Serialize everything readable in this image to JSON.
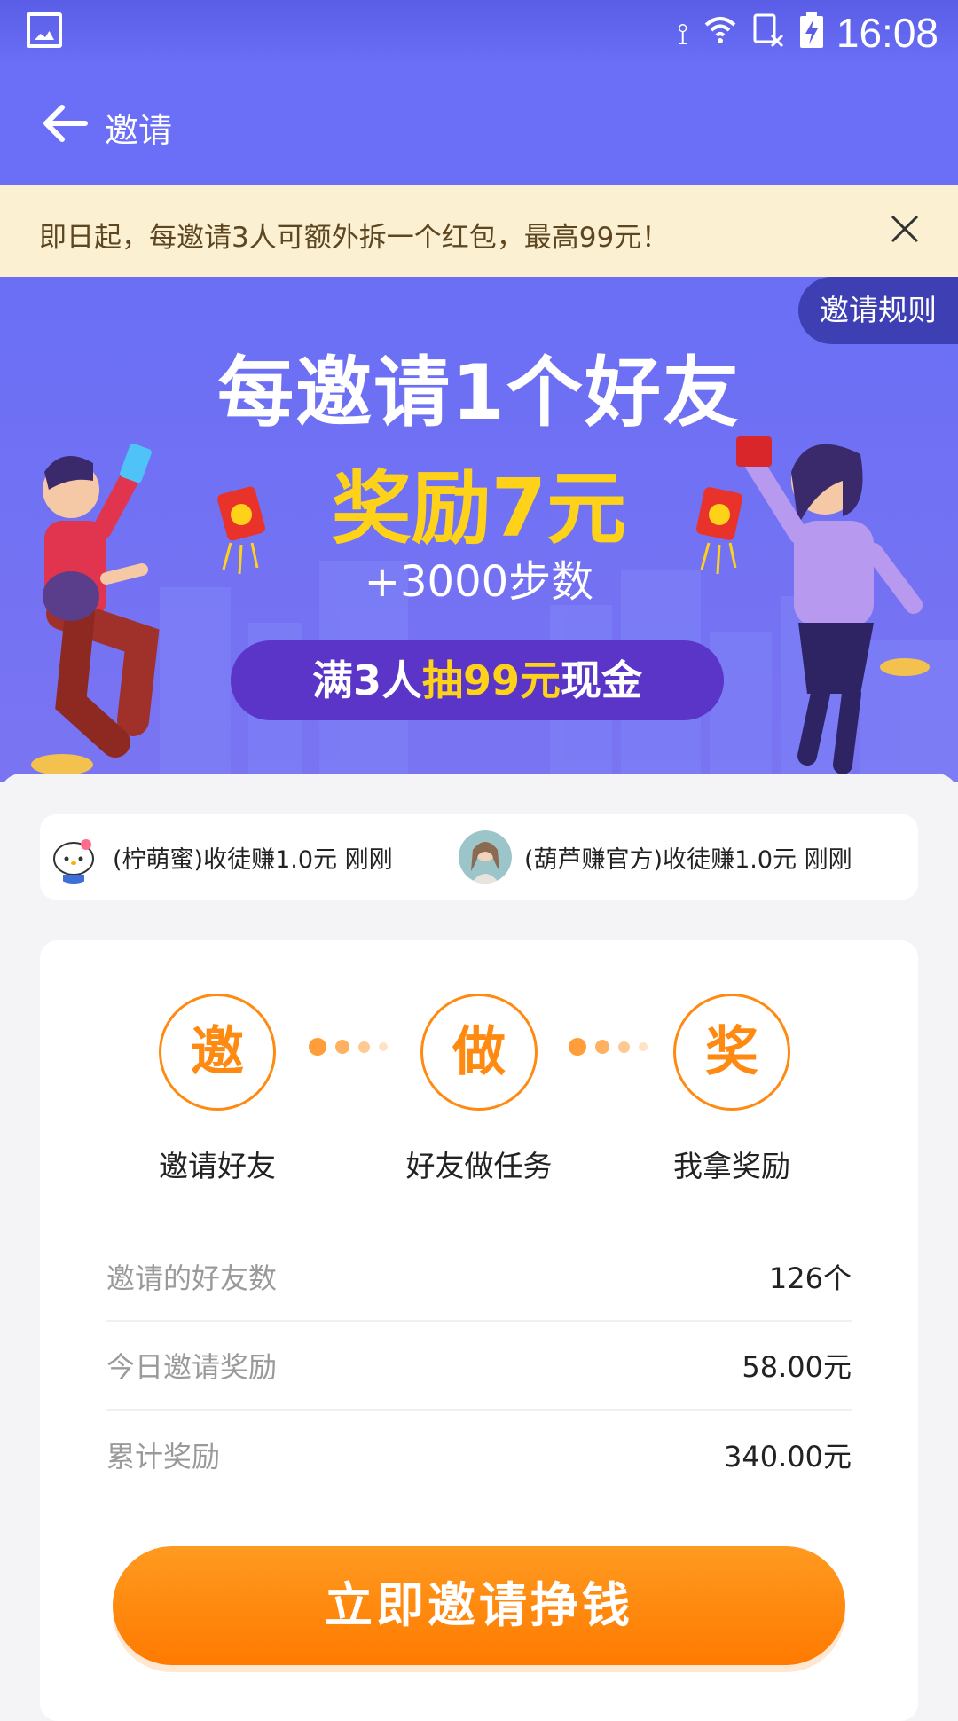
{
  "status_bar": {
    "time": "16:08",
    "icons": [
      "image-icon",
      "vibrate-mute-icon",
      "wifi-icon",
      "no-sim-icon",
      "battery-charging-icon"
    ]
  },
  "app_bar": {
    "title": "邀请"
  },
  "notice": {
    "text": "即日起，每邀请3人可额外拆一个红包，最高99元！"
  },
  "banner": {
    "rules_label": "邀请规则",
    "line1": "每邀请1个好友",
    "line2": "奖励7元",
    "line3": "+3000步数",
    "pill_prefix": "满3人",
    "pill_highlight": "抽99元",
    "pill_suffix": "现金"
  },
  "ticker": [
    {
      "text": "(柠萌蜜)收徒赚1.0元 刚刚"
    },
    {
      "text": "(葫芦赚官方)收徒赚1.0元 刚刚"
    }
  ],
  "steps": [
    {
      "char": "邀",
      "label": "邀请好友"
    },
    {
      "char": "做",
      "label": "好友做任务"
    },
    {
      "char": "奖",
      "label": "我拿奖励"
    }
  ],
  "stats": [
    {
      "label": "邀请的好友数",
      "value": "126个"
    },
    {
      "label": "今日邀请奖励",
      "value": "58.00元"
    },
    {
      "label": "累计奖励",
      "value": "340.00元"
    }
  ],
  "cta_label": "立即邀请挣钱",
  "footer_text": "",
  "colors": {
    "primary": "#6b6ff7",
    "accent": "#ff8a12",
    "gold": "#ffd21a"
  }
}
